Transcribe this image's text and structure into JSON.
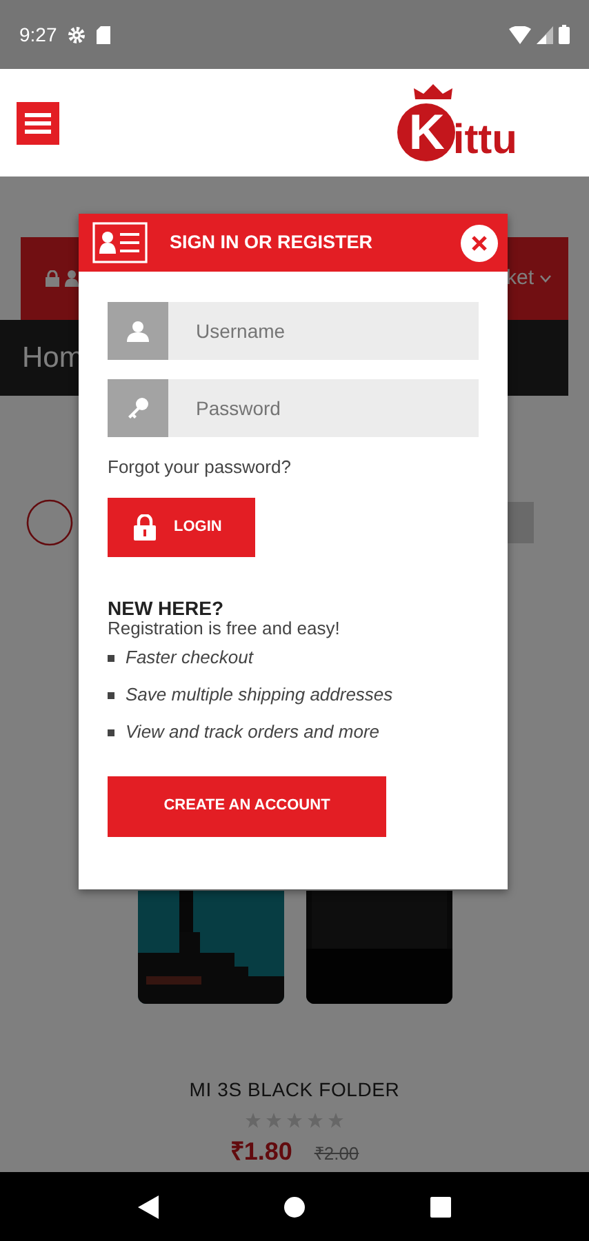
{
  "status_bar": {
    "time": "9:27"
  },
  "header": {
    "logo": {
      "initial": "K",
      "rest": "ittu"
    }
  },
  "background": {
    "account_bar_text": "ket",
    "breadcrumb": "Hom",
    "product": {
      "title": "MI 3S BLACK FOLDER",
      "stars": 0,
      "price": "₹1.80",
      "old_price": "₹2.00"
    }
  },
  "modal": {
    "title": "SIGN IN OR REGISTER",
    "fields": [
      {
        "kind": "text",
        "placeholder": "Username"
      },
      {
        "kind": "password",
        "placeholder": "Password"
      }
    ],
    "forgot_link": "Forgot your password?",
    "login_button": "LOGIN",
    "new_heading": "NEW HERE?",
    "new_text": "Registration is free and easy!",
    "benefits": [
      "Faster checkout",
      "Save multiple shipping addresses",
      "View and track orders and more"
    ],
    "create_button": "CREATE AN ACCOUNT"
  }
}
